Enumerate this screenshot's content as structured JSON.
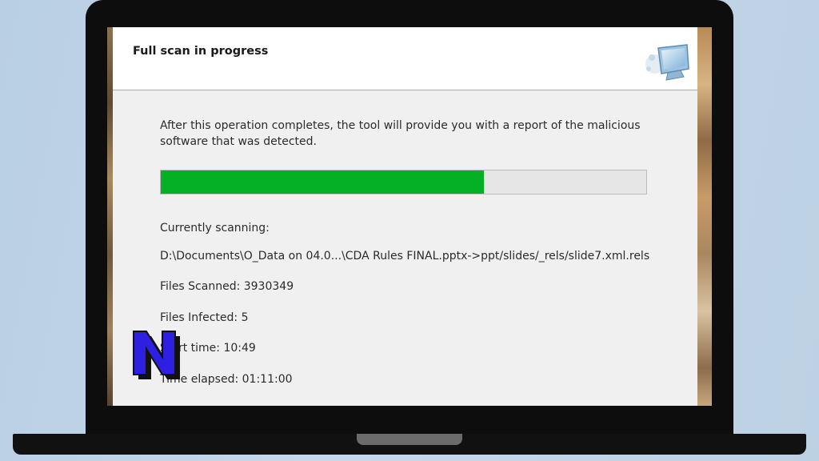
{
  "dialog": {
    "title": "Full scan in progress",
    "description": "After this operation completes, the tool will provide you with a report of the malicious software that was detected.",
    "progress_fraction": 0.665,
    "progress_color": "#06b025",
    "currently_scanning_label": "Currently scanning:",
    "current_file": "D:\\Documents\\O_Data on 04.0...\\CDA Rules FINAL.pptx->ppt/slides/_rels/slide7.xml.rels",
    "files_scanned": "Files Scanned: 3930349",
    "files_infected": "Files Infected: 5",
    "start_time": "Start time: 10:49",
    "time_elapsed": "Time elapsed: 01:11:00",
    "header_icon": "computer-scan-icon"
  },
  "overlay_logo": {
    "letter": "N",
    "color": "#2f1fe0"
  }
}
